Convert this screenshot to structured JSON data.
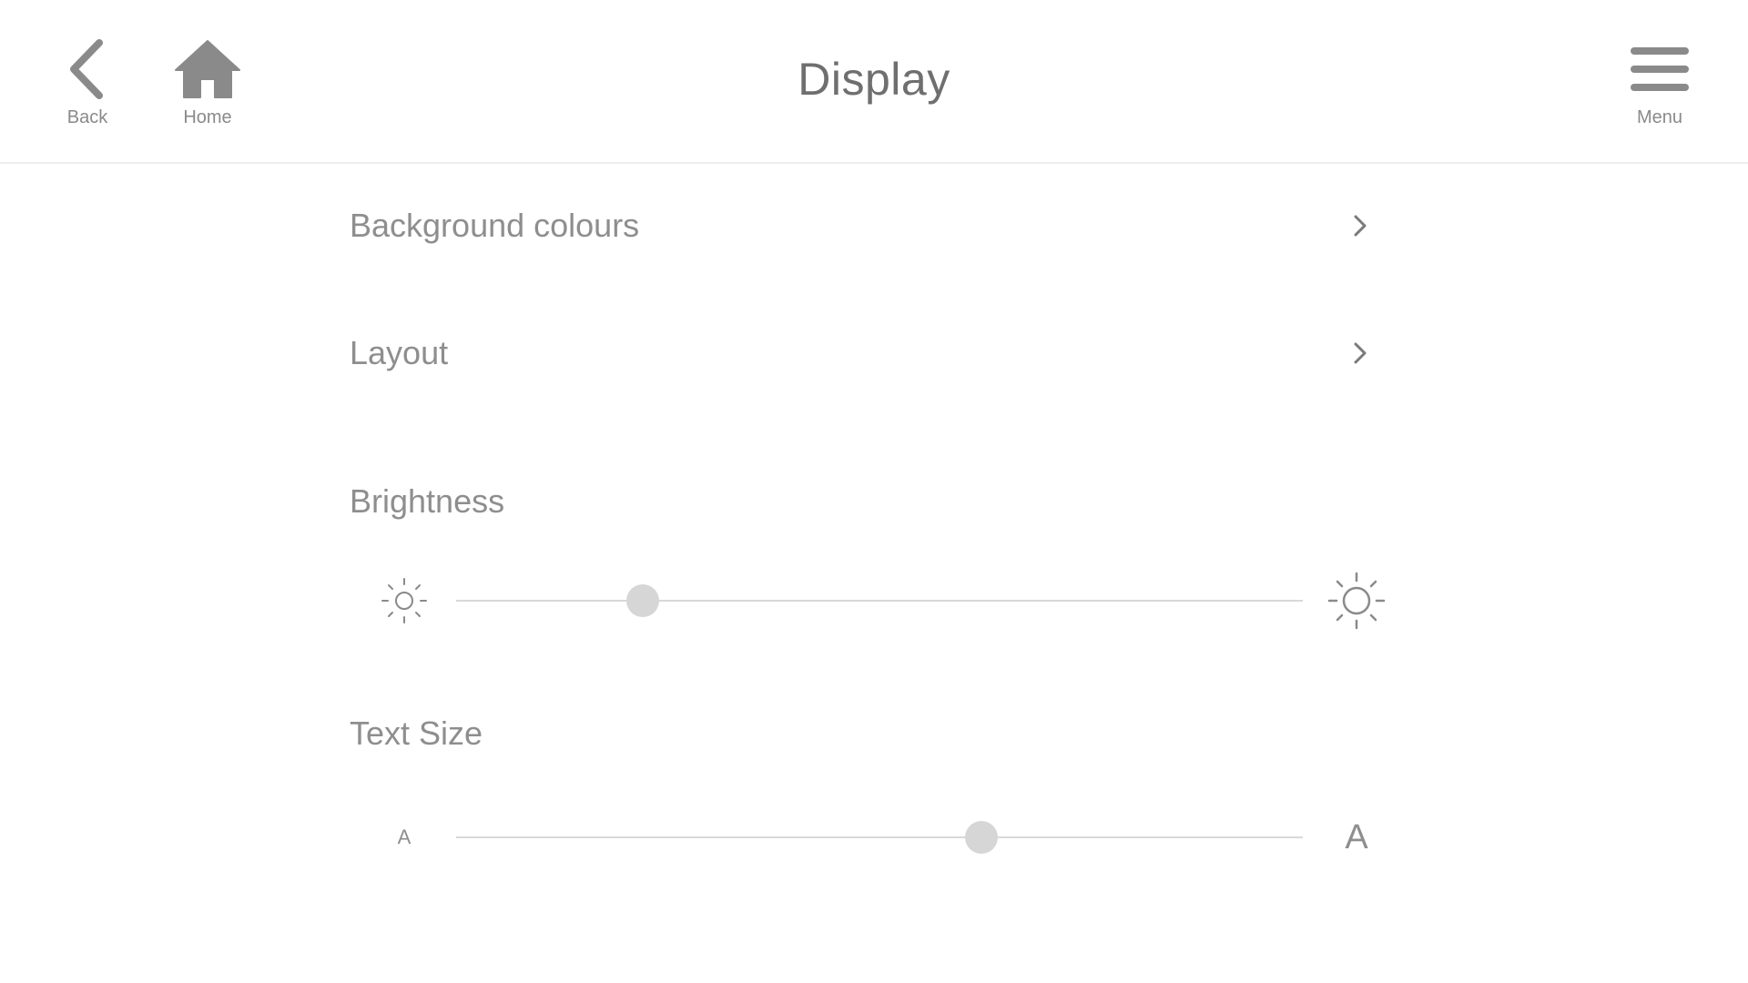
{
  "header": {
    "title": "Display",
    "back_label": "Back",
    "home_label": "Home",
    "menu_label": "Menu"
  },
  "rows": [
    {
      "label": "Background colours",
      "icon": "chevron-right-icon"
    },
    {
      "label": "Layout",
      "icon": "chevron-right-icon"
    }
  ],
  "brightness": {
    "label": "Brightness",
    "min_icon": "sun-small-icon",
    "max_icon": "sun-large-icon",
    "value": 0.22
  },
  "text_size": {
    "label": "Text Size",
    "min_label": "A",
    "max_label": "A",
    "value": 0.62
  },
  "colors": {
    "text": "#8e8e8e",
    "title": "#6f6f6f",
    "icon": "#8a8a8a",
    "track": "#d9d9d9",
    "thumb": "#d6d6d6",
    "divider": "#eeeeee",
    "background": "#ffffff"
  }
}
